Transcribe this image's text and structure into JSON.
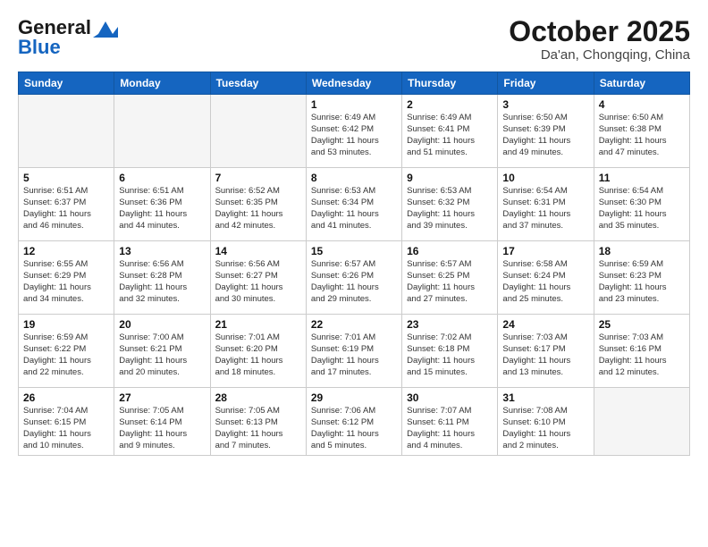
{
  "logo": {
    "line1": "General",
    "line2": "Blue"
  },
  "title": "October 2025",
  "subtitle": "Da'an, Chongqing, China",
  "headers": [
    "Sunday",
    "Monday",
    "Tuesday",
    "Wednesday",
    "Thursday",
    "Friday",
    "Saturday"
  ],
  "weeks": [
    [
      {
        "day": "",
        "info": ""
      },
      {
        "day": "",
        "info": ""
      },
      {
        "day": "",
        "info": ""
      },
      {
        "day": "1",
        "info": "Sunrise: 6:49 AM\nSunset: 6:42 PM\nDaylight: 11 hours\nand 53 minutes."
      },
      {
        "day": "2",
        "info": "Sunrise: 6:49 AM\nSunset: 6:41 PM\nDaylight: 11 hours\nand 51 minutes."
      },
      {
        "day": "3",
        "info": "Sunrise: 6:50 AM\nSunset: 6:39 PM\nDaylight: 11 hours\nand 49 minutes."
      },
      {
        "day": "4",
        "info": "Sunrise: 6:50 AM\nSunset: 6:38 PM\nDaylight: 11 hours\nand 47 minutes."
      }
    ],
    [
      {
        "day": "5",
        "info": "Sunrise: 6:51 AM\nSunset: 6:37 PM\nDaylight: 11 hours\nand 46 minutes."
      },
      {
        "day": "6",
        "info": "Sunrise: 6:51 AM\nSunset: 6:36 PM\nDaylight: 11 hours\nand 44 minutes."
      },
      {
        "day": "7",
        "info": "Sunrise: 6:52 AM\nSunset: 6:35 PM\nDaylight: 11 hours\nand 42 minutes."
      },
      {
        "day": "8",
        "info": "Sunrise: 6:53 AM\nSunset: 6:34 PM\nDaylight: 11 hours\nand 41 minutes."
      },
      {
        "day": "9",
        "info": "Sunrise: 6:53 AM\nSunset: 6:32 PM\nDaylight: 11 hours\nand 39 minutes."
      },
      {
        "day": "10",
        "info": "Sunrise: 6:54 AM\nSunset: 6:31 PM\nDaylight: 11 hours\nand 37 minutes."
      },
      {
        "day": "11",
        "info": "Sunrise: 6:54 AM\nSunset: 6:30 PM\nDaylight: 11 hours\nand 35 minutes."
      }
    ],
    [
      {
        "day": "12",
        "info": "Sunrise: 6:55 AM\nSunset: 6:29 PM\nDaylight: 11 hours\nand 34 minutes."
      },
      {
        "day": "13",
        "info": "Sunrise: 6:56 AM\nSunset: 6:28 PM\nDaylight: 11 hours\nand 32 minutes."
      },
      {
        "day": "14",
        "info": "Sunrise: 6:56 AM\nSunset: 6:27 PM\nDaylight: 11 hours\nand 30 minutes."
      },
      {
        "day": "15",
        "info": "Sunrise: 6:57 AM\nSunset: 6:26 PM\nDaylight: 11 hours\nand 29 minutes."
      },
      {
        "day": "16",
        "info": "Sunrise: 6:57 AM\nSunset: 6:25 PM\nDaylight: 11 hours\nand 27 minutes."
      },
      {
        "day": "17",
        "info": "Sunrise: 6:58 AM\nSunset: 6:24 PM\nDaylight: 11 hours\nand 25 minutes."
      },
      {
        "day": "18",
        "info": "Sunrise: 6:59 AM\nSunset: 6:23 PM\nDaylight: 11 hours\nand 23 minutes."
      }
    ],
    [
      {
        "day": "19",
        "info": "Sunrise: 6:59 AM\nSunset: 6:22 PM\nDaylight: 11 hours\nand 22 minutes."
      },
      {
        "day": "20",
        "info": "Sunrise: 7:00 AM\nSunset: 6:21 PM\nDaylight: 11 hours\nand 20 minutes."
      },
      {
        "day": "21",
        "info": "Sunrise: 7:01 AM\nSunset: 6:20 PM\nDaylight: 11 hours\nand 18 minutes."
      },
      {
        "day": "22",
        "info": "Sunrise: 7:01 AM\nSunset: 6:19 PM\nDaylight: 11 hours\nand 17 minutes."
      },
      {
        "day": "23",
        "info": "Sunrise: 7:02 AM\nSunset: 6:18 PM\nDaylight: 11 hours\nand 15 minutes."
      },
      {
        "day": "24",
        "info": "Sunrise: 7:03 AM\nSunset: 6:17 PM\nDaylight: 11 hours\nand 13 minutes."
      },
      {
        "day": "25",
        "info": "Sunrise: 7:03 AM\nSunset: 6:16 PM\nDaylight: 11 hours\nand 12 minutes."
      }
    ],
    [
      {
        "day": "26",
        "info": "Sunrise: 7:04 AM\nSunset: 6:15 PM\nDaylight: 11 hours\nand 10 minutes."
      },
      {
        "day": "27",
        "info": "Sunrise: 7:05 AM\nSunset: 6:14 PM\nDaylight: 11 hours\nand 9 minutes."
      },
      {
        "day": "28",
        "info": "Sunrise: 7:05 AM\nSunset: 6:13 PM\nDaylight: 11 hours\nand 7 minutes."
      },
      {
        "day": "29",
        "info": "Sunrise: 7:06 AM\nSunset: 6:12 PM\nDaylight: 11 hours\nand 5 minutes."
      },
      {
        "day": "30",
        "info": "Sunrise: 7:07 AM\nSunset: 6:11 PM\nDaylight: 11 hours\nand 4 minutes."
      },
      {
        "day": "31",
        "info": "Sunrise: 7:08 AM\nSunset: 6:10 PM\nDaylight: 11 hours\nand 2 minutes."
      },
      {
        "day": "",
        "info": ""
      }
    ]
  ]
}
